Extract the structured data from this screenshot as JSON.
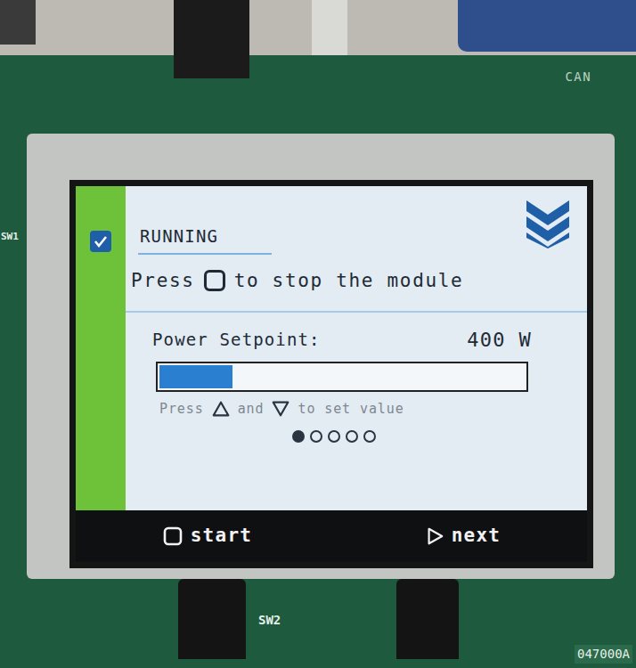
{
  "board": {
    "silkscreen": {
      "can": "CAN",
      "sw1": "SW1",
      "sw2": "SW2",
      "part": "047000A"
    }
  },
  "screen": {
    "status": {
      "label": "RUNNING",
      "checked": true
    },
    "instruction": {
      "before": "Press",
      "after": "to stop the module"
    },
    "setpoint": {
      "label": "Power Setpoint:",
      "value": "400 W",
      "level": 0.2
    },
    "hint": {
      "parts": [
        "Press",
        "and",
        "to set value"
      ]
    },
    "pages": [
      {
        "selected": true
      },
      {
        "selected": false
      },
      {
        "selected": false
      },
      {
        "selected": false
      },
      {
        "selected": false
      }
    ],
    "softkeys": [
      {
        "label": "start",
        "kind": "toggle"
      },
      {
        "label": "next",
        "kind": "forward"
      }
    ]
  }
}
